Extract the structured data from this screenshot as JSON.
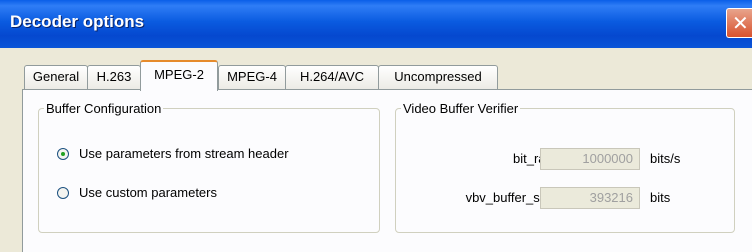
{
  "window": {
    "title": "Decoder options"
  },
  "tabs": [
    {
      "label": "General"
    },
    {
      "label": "H.263"
    },
    {
      "label": "MPEG-2",
      "active": true
    },
    {
      "label": "MPEG-4"
    },
    {
      "label": "H.264/AVC"
    },
    {
      "label": "Uncompressed"
    }
  ],
  "buffer_config": {
    "title": "Buffer Configuration",
    "options": [
      {
        "label": "Use parameters from stream header",
        "checked": true
      },
      {
        "label": "Use custom parameters",
        "checked": false
      }
    ]
  },
  "vbv": {
    "title": "Video Buffer Verifier",
    "fields": [
      {
        "label": "bit_rate:",
        "value": "1000000",
        "unit": "bits/s"
      },
      {
        "label": "vbv_buffer_size:",
        "value": "393216",
        "unit": "bits"
      }
    ]
  },
  "icons": {
    "close": "close-icon"
  },
  "colors": {
    "titlebar": "#0a55d8",
    "active_tab_highlight": "#e68b2c",
    "radio_dot": "#21a121"
  }
}
